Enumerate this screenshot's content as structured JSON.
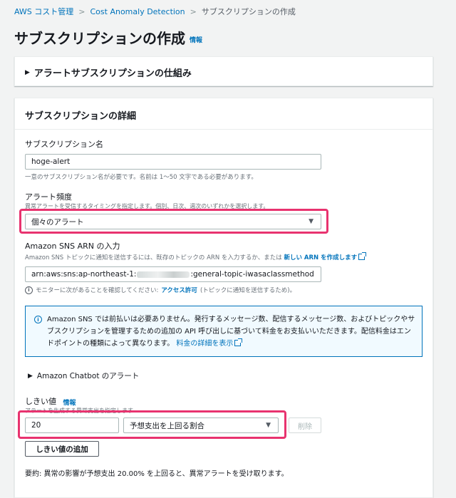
{
  "breadcrumb": {
    "items": [
      "AWS コスト管理",
      "Cost Anomaly Detection"
    ],
    "current": "サブスクリプションの作成",
    "separator": ">"
  },
  "page": {
    "title": "サブスクリプションの作成",
    "info": "情報"
  },
  "expandable": {
    "label": "アラートサブスクリプションの仕組み"
  },
  "details": {
    "title": "サブスクリプションの詳細",
    "name": {
      "label": "サブスクリプション名",
      "value": "hoge-alert",
      "hint": "一意のサブスクリプション名が必要です。名前は 1〜50 文字である必要があります。"
    },
    "frequency": {
      "label": "アラート頻度",
      "hint": "異常アラートを受信するタイミングを指定します。個別、日次、週次のいずれかを選択します。",
      "selected": "個々のアラート"
    },
    "sns": {
      "label": "Amazon SNS ARN の入力",
      "hint": "Amazon SNS トピックに通知を送信するには、既存のトピックの ARN を入力するか、または",
      "create_link": "新しい ARN を作成します",
      "value_prefix": "arn:aws:sns:ap-northeast-1:",
      "value_suffix": ":general-topic-iwasaclassmethod",
      "note_prefix": "モニターに次があることを確認してください:",
      "note_link": "アクセス許可",
      "note_suffix": "(トピックに通知を送信するため)。"
    },
    "alert": {
      "text": "Amazon SNS では前払いは必要ありません。発行するメッセージ数、配信するメッセージ数、およびトピックやサブスクリプションを管理するための追加の API 呼び出しに基づいて料金をお支払いいただきます。配信料金はエンドポイントの種類によって異なります。",
      "link": "料金の詳細を表示"
    },
    "chatbot": {
      "label": "Amazon Chatbot のアラート"
    },
    "threshold": {
      "label": "しきい値",
      "info": "情報",
      "hint": "アラートを生成する異常支出を指定します",
      "value": "20",
      "type_selected": "予想支出を上回る割合",
      "delete_button": "削除",
      "add_button": "しきい値の追加"
    },
    "summary": "要約: 異常の影響が予想支出 20.00% を上回ると、異常アラートを受け取ります。"
  },
  "colors": {
    "highlight": "#e8336f",
    "link": "#0073bb",
    "info_bg": "#f1faff"
  }
}
